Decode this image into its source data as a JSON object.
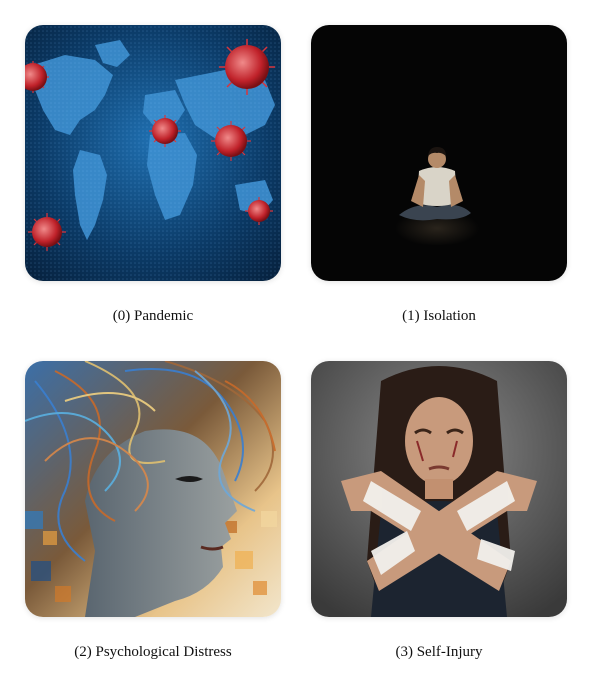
{
  "panels": [
    {
      "caption": "(0) Pandemic",
      "image": "world-map-with-virus-particles"
    },
    {
      "caption": "(1) Isolation",
      "image": "person-sitting-alone-in-dark"
    },
    {
      "caption": "(2) Psychological Distress",
      "image": "abstract-face-with-tangled-wires"
    },
    {
      "caption": "(3) Self-Injury",
      "image": "person-with-bandaged-crossed-arms"
    }
  ],
  "colors": {
    "pandemic_bg": "#0b3a66",
    "isolation_bg": "#050505",
    "distress_accent": "#e58a2a",
    "selfinjury_bg": "#5f5f5f",
    "caption_text": "#111111"
  }
}
